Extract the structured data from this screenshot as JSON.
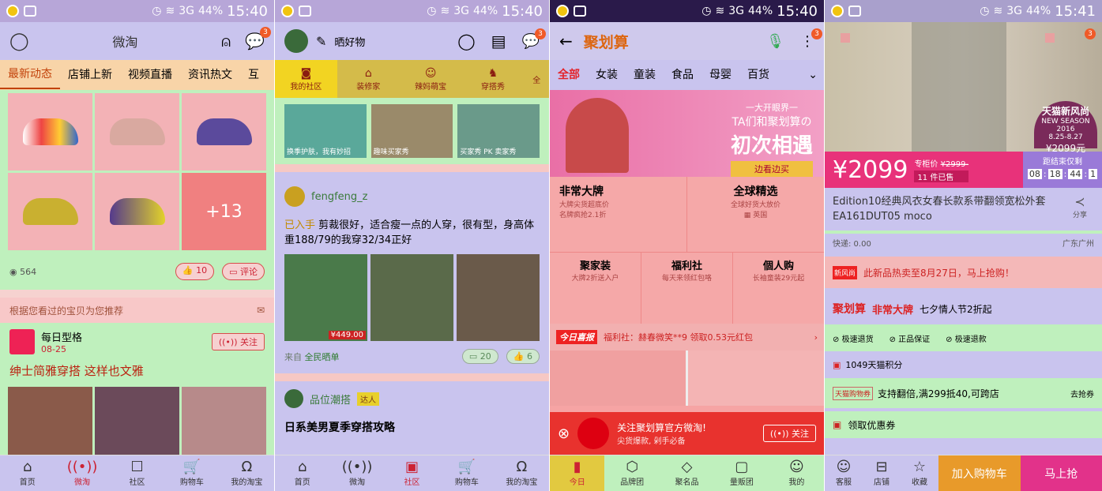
{
  "status": {
    "screen1_time": "15:40",
    "screen2_time": "15:40",
    "screen3_time": "15:40",
    "screen4_time": "15:41",
    "battery": "44%",
    "net": "3G"
  },
  "s1": {
    "title": "微淘",
    "badge": "3",
    "tabs": [
      "最新动态",
      "店铺上新",
      "视频直播",
      "资讯热文",
      "互"
    ],
    "more_count": "+13",
    "views": "564",
    "likes": "10",
    "comment": "评论",
    "recommend_header": "根据您看过的宝贝为您推荐",
    "shop_name": "每日型格",
    "shop_date": "08-25",
    "follow": "关注",
    "post_title": "绅士简雅穿搭 这样也文雅",
    "nav": [
      "首页",
      "微淘",
      "社区",
      "购物车",
      "我的淘宝"
    ]
  },
  "s2": {
    "title": "晒好物",
    "badge": "3",
    "cats": [
      "我的社区",
      "装修家",
      "辣妈萌宝",
      "穿搭秀",
      "全"
    ],
    "thumbs": [
      "换季护肤，我有妙招",
      "趣味买家秀",
      "买家秀 PK 卖家秀"
    ],
    "user": "fengfeng_z",
    "tag": "已入手",
    "text": "剪裁很好，适合瘦一点的人穿，很有型，身高体重188/79的我穿32/34正好",
    "price": "¥449.00",
    "source_label": "来自",
    "source": "全民晒单",
    "comments": "20",
    "likes": "6",
    "user2": "品位潮搭",
    "user2_badge": "达人",
    "post2_title": "日系美男夏季穿搭攻略",
    "nav": [
      "首页",
      "微淘",
      "社区",
      "购物车",
      "我的淘宝"
    ]
  },
  "s3": {
    "title": "聚划算",
    "badge": "3",
    "tabs": [
      "全部",
      "女装",
      "童装",
      "食品",
      "母婴",
      "百货"
    ],
    "banner_small": "一大开眼界一",
    "banner_line1": "TA们和聚划算の",
    "banner_line2": "初次相遇",
    "banner_btn": "边看边买",
    "blocks": [
      {
        "title": "非常大牌",
        "sub1": "大牌尖货超底价",
        "sub2": "名牌疯抢2.1折"
      },
      {
        "title": "全球精选",
        "sub1": "全球好货大放价",
        "sub2": "英国"
      }
    ],
    "blocks2": [
      {
        "title": "聚家装",
        "sub": "大牌2折送入户"
      },
      {
        "title": "福利社",
        "sub": "每天来领红包咯"
      },
      {
        "title": "個人购",
        "sub": "长袖童装29元起"
      }
    ],
    "news_label": "今日喜报",
    "news_text": "福利社：赫春微笑**9 领取0.53元红包",
    "follow_text": "关注聚划算官方微淘!",
    "follow_sub": "尖货爆款, 剁手必备",
    "follow_btn": "关注",
    "nav": [
      "今日",
      "品牌团",
      "聚名品",
      "量贩团",
      "我的"
    ]
  },
  "s4": {
    "badge": "3",
    "banner_brand": "天猫新风尚",
    "banner_brand_sub": "NEW SEASON 2016",
    "banner_date": "8.25-8.27",
    "banner_price": "¥2099元",
    "price": "¥2099",
    "counter_label": "专柜价",
    "counter_price": "¥2999-",
    "sold": "11 件已售",
    "end_label": "距结束仅剩",
    "countdown": [
      "08",
      "18",
      "44",
      "1"
    ],
    "product_title": "Edition10经典风衣女春长款系带翻领宽松外套EA161DUT05 moco",
    "share": "分享",
    "shipping": "快递: 0.00",
    "location": "广东广州",
    "notice_tag": "新风尚",
    "notice": "此新品热卖至8月27日，马上抢购！",
    "promo_brand": "聚划算",
    "promo_big": "非常大牌",
    "promo_text": "七夕情人节2折起",
    "guarantees": [
      "极速退货",
      "正品保证",
      "极速退款"
    ],
    "points": "1049天猫积分",
    "coupon_tag": "天猫购物券",
    "coupon_text": "支持翻倍,满299抵40,可跨店",
    "coupon_go": "去抢券",
    "get_coupon": "领取优惠券",
    "nav": [
      "客服",
      "店铺",
      "收藏"
    ],
    "cart_btn": "加入购物车",
    "buy_btn": "马上抢"
  }
}
